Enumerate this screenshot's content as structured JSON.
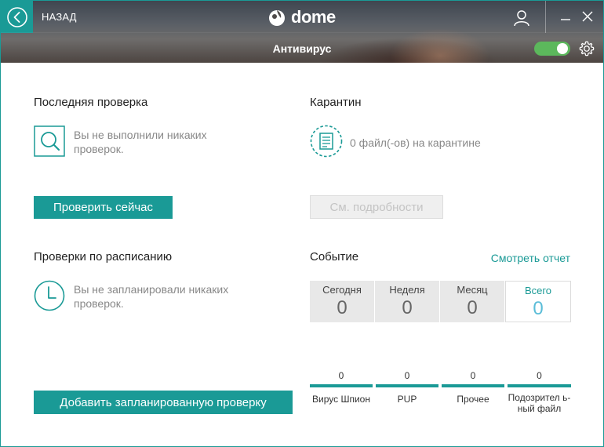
{
  "header": {
    "back_label": "НАЗАД",
    "logo_text": "dome",
    "page_title": "Антивирус",
    "protection_enabled": true
  },
  "last_scan": {
    "title": "Последняя проверка",
    "description": "Вы не выполнили никаких проверок.",
    "button": "Проверить сейчас"
  },
  "quarantine": {
    "title": "Карантин",
    "description": "0 файл(-ов) на карантине",
    "button": "См. подробности"
  },
  "scheduled": {
    "title": "Проверки по расписанию",
    "description": "Вы не запланировали никаких проверок.",
    "button": "Добавить запланированную проверку"
  },
  "events": {
    "title": "Событие",
    "report_link": "Смотреть отчет",
    "tabs": [
      {
        "label": "Сегодня",
        "count": "0"
      },
      {
        "label": "Неделя",
        "count": "0"
      },
      {
        "label": "Месяц",
        "count": "0"
      },
      {
        "label": "Всего",
        "count": "0"
      }
    ],
    "active_tab": 3,
    "stats": [
      {
        "label": "Вирус Шпион",
        "value": "0"
      },
      {
        "label": "PUP",
        "value": "0"
      },
      {
        "label": "Прочее",
        "value": "0"
      },
      {
        "label": "Подозрител ь-ный файл",
        "value": "0"
      }
    ]
  },
  "colors": {
    "accent": "#1a9a96",
    "toggle_on": "#5cb85c",
    "active_count": "#5bbdd8"
  }
}
